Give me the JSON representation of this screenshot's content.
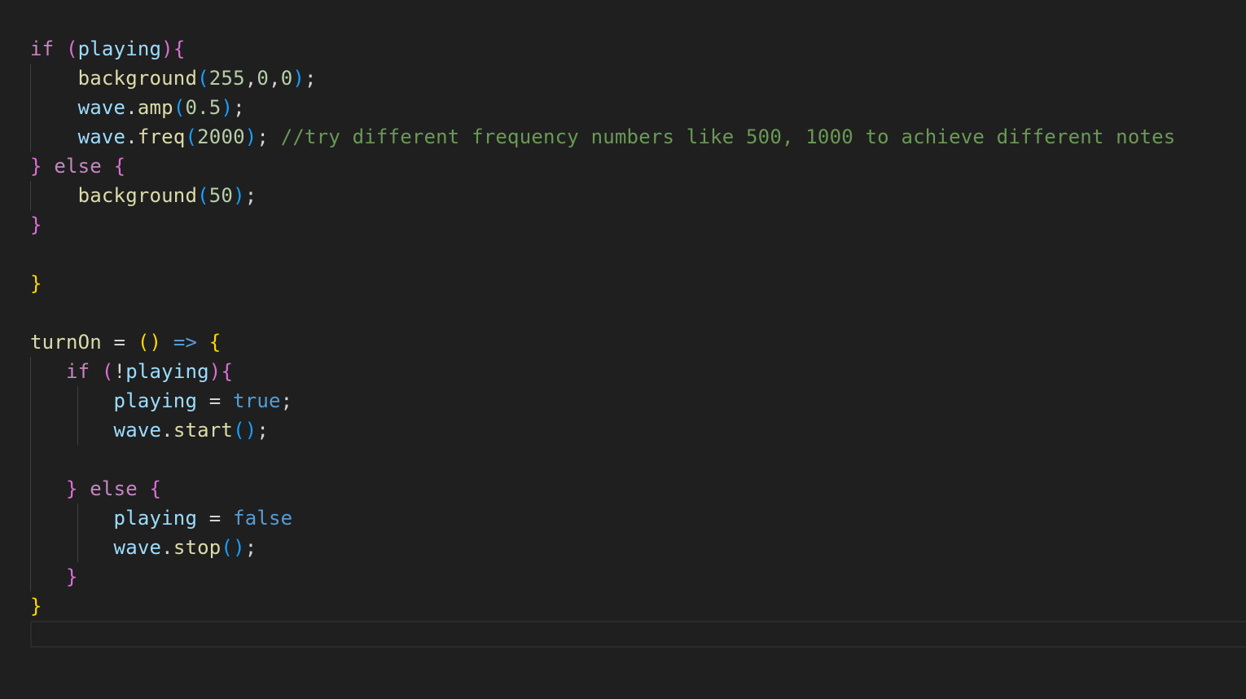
{
  "editor": {
    "lines": [
      {
        "id": "line-if-playing",
        "tokens": [
          {
            "t": "if",
            "c": "kw"
          },
          {
            "t": " ",
            "c": "op"
          },
          {
            "t": "(",
            "c": "p2"
          },
          {
            "t": "playing",
            "c": "var"
          },
          {
            "t": ")",
            "c": "p2"
          },
          {
            "t": "{",
            "c": "p2"
          }
        ]
      },
      {
        "id": "line-background-red",
        "tokens": [
          {
            "t": "    ",
            "c": "op"
          },
          {
            "t": "background",
            "c": "fn"
          },
          {
            "t": "(",
            "c": "p3"
          },
          {
            "t": "255",
            "c": "num"
          },
          {
            "t": ",",
            "c": "op"
          },
          {
            "t": "0",
            "c": "num"
          },
          {
            "t": ",",
            "c": "op"
          },
          {
            "t": "0",
            "c": "num"
          },
          {
            "t": ")",
            "c": "p3"
          },
          {
            "t": ";",
            "c": "op"
          }
        ]
      },
      {
        "id": "line-wave-amp",
        "tokens": [
          {
            "t": "    ",
            "c": "op"
          },
          {
            "t": "wave",
            "c": "var"
          },
          {
            "t": ".",
            "c": "op"
          },
          {
            "t": "amp",
            "c": "fn"
          },
          {
            "t": "(",
            "c": "p3"
          },
          {
            "t": "0.5",
            "c": "num"
          },
          {
            "t": ")",
            "c": "p3"
          },
          {
            "t": ";",
            "c": "op"
          }
        ]
      },
      {
        "id": "line-wave-freq",
        "tokens": [
          {
            "t": "    ",
            "c": "op"
          },
          {
            "t": "wave",
            "c": "var"
          },
          {
            "t": ".",
            "c": "op"
          },
          {
            "t": "freq",
            "c": "fn"
          },
          {
            "t": "(",
            "c": "p3"
          },
          {
            "t": "2000",
            "c": "num"
          },
          {
            "t": ")",
            "c": "p3"
          },
          {
            "t": "; ",
            "c": "op"
          },
          {
            "t": "//try different frequency numbers like 500, 1000 to achieve different notes",
            "c": "cm"
          }
        ]
      },
      {
        "id": "line-else-1",
        "tokens": [
          {
            "t": "}",
            "c": "p2"
          },
          {
            "t": " ",
            "c": "op"
          },
          {
            "t": "else",
            "c": "kw"
          },
          {
            "t": " ",
            "c": "op"
          },
          {
            "t": "{",
            "c": "p2"
          }
        ]
      },
      {
        "id": "line-background-50",
        "tokens": [
          {
            "t": "    ",
            "c": "op"
          },
          {
            "t": "background",
            "c": "fn"
          },
          {
            "t": "(",
            "c": "p3"
          },
          {
            "t": "50",
            "c": "num"
          },
          {
            "t": ")",
            "c": "p3"
          },
          {
            "t": ";",
            "c": "op"
          }
        ]
      },
      {
        "id": "line-close-else-1",
        "tokens": [
          {
            "t": "}",
            "c": "p2"
          }
        ]
      },
      {
        "id": "line-blank-1",
        "tokens": []
      },
      {
        "id": "line-close-draw",
        "tokens": [
          {
            "t": "}",
            "c": "p1"
          }
        ]
      },
      {
        "id": "line-blank-2",
        "tokens": []
      },
      {
        "id": "line-turnon",
        "tokens": [
          {
            "t": "turnOn",
            "c": "fn"
          },
          {
            "t": " = ",
            "c": "op"
          },
          {
            "t": "()",
            "c": "p1"
          },
          {
            "t": " ",
            "c": "op"
          },
          {
            "t": "=>",
            "c": "kw2"
          },
          {
            "t": " ",
            "c": "op"
          },
          {
            "t": "{",
            "c": "p1"
          }
        ]
      },
      {
        "id": "line-if-not-playing",
        "tokens": [
          {
            "t": "   ",
            "c": "op"
          },
          {
            "t": "if",
            "c": "kw"
          },
          {
            "t": " ",
            "c": "op"
          },
          {
            "t": "(",
            "c": "p2"
          },
          {
            "t": "!",
            "c": "op"
          },
          {
            "t": "playing",
            "c": "var"
          },
          {
            "t": ")",
            "c": "p2"
          },
          {
            "t": "{",
            "c": "p2"
          }
        ]
      },
      {
        "id": "line-playing-true",
        "tokens": [
          {
            "t": "       ",
            "c": "op"
          },
          {
            "t": "playing",
            "c": "var"
          },
          {
            "t": " = ",
            "c": "op"
          },
          {
            "t": "true",
            "c": "kw2"
          },
          {
            "t": ";",
            "c": "op"
          }
        ]
      },
      {
        "id": "line-wave-start",
        "tokens": [
          {
            "t": "       ",
            "c": "op"
          },
          {
            "t": "wave",
            "c": "var"
          },
          {
            "t": ".",
            "c": "op"
          },
          {
            "t": "start",
            "c": "fn"
          },
          {
            "t": "()",
            "c": "p3"
          },
          {
            "t": ";",
            "c": "op"
          }
        ]
      },
      {
        "id": "line-blank-3",
        "tokens": []
      },
      {
        "id": "line-else-2",
        "tokens": [
          {
            "t": "   ",
            "c": "op"
          },
          {
            "t": "}",
            "c": "p2"
          },
          {
            "t": " ",
            "c": "op"
          },
          {
            "t": "else",
            "c": "kw"
          },
          {
            "t": " ",
            "c": "op"
          },
          {
            "t": "{",
            "c": "p2"
          }
        ]
      },
      {
        "id": "line-playing-false",
        "tokens": [
          {
            "t": "       ",
            "c": "op"
          },
          {
            "t": "playing",
            "c": "var"
          },
          {
            "t": " = ",
            "c": "op"
          },
          {
            "t": "false",
            "c": "kw2"
          }
        ]
      },
      {
        "id": "line-wave-stop",
        "tokens": [
          {
            "t": "       ",
            "c": "op"
          },
          {
            "t": "wave",
            "c": "var"
          },
          {
            "t": ".",
            "c": "op"
          },
          {
            "t": "stop",
            "c": "fn"
          },
          {
            "t": "()",
            "c": "p3"
          },
          {
            "t": ";",
            "c": "op"
          }
        ]
      },
      {
        "id": "line-close-else-2",
        "tokens": [
          {
            "t": "   ",
            "c": "op"
          },
          {
            "t": "}",
            "c": "p2"
          }
        ]
      },
      {
        "id": "line-close-turnon",
        "tokens": [
          {
            "t": "}",
            "c": "p1"
          }
        ]
      }
    ]
  },
  "colors": {
    "background": "#1f1f1f",
    "keyword": "#c586c0",
    "keyword_blue": "#569cd6",
    "variable": "#9cdcfe",
    "function": "#dcdcaa",
    "number": "#b5cea8",
    "comment": "#6a9955",
    "bracket_gold": "#ffd700",
    "bracket_orchid": "#da70d6",
    "bracket_blue": "#179fff"
  }
}
